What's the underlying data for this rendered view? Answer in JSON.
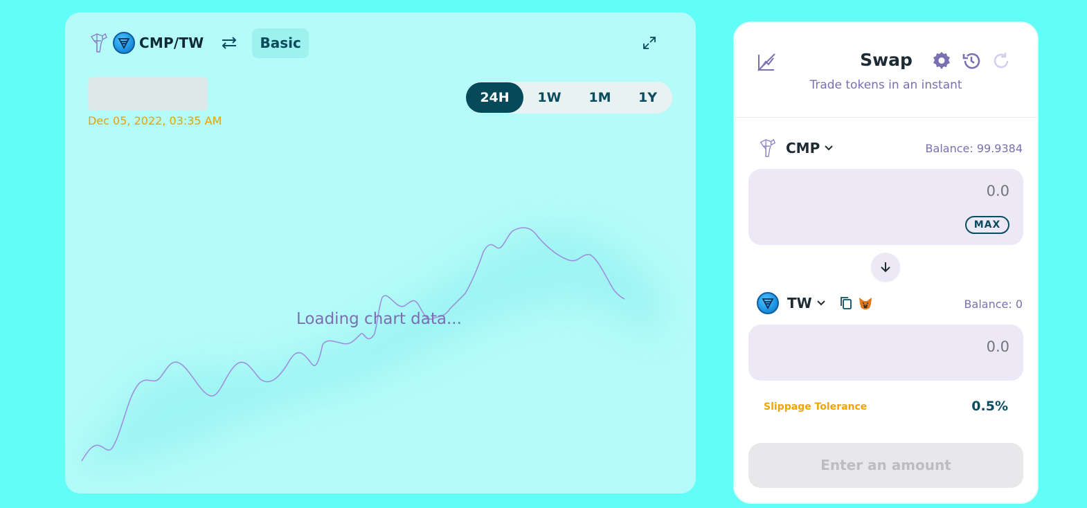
{
  "chart_panel": {
    "pair_label": "CMP/TW",
    "basic_label": "Basic",
    "date": "Dec 05, 2022, 03:35 AM",
    "ranges": [
      "24H",
      "1W",
      "1M",
      "1Y"
    ],
    "active_range": "24H",
    "loading_text": "Loading chart data..."
  },
  "swap": {
    "title": "Swap",
    "subtitle": "Trade tokens in an instant",
    "from": {
      "symbol": "CMP",
      "balance": "Balance: 99.9384",
      "amount_placeholder": "0.0",
      "max_label": "MAX"
    },
    "to": {
      "symbol": "TW",
      "balance": "Balance: 0",
      "amount_placeholder": "0.0"
    },
    "slippage_label": "Slippage Tolerance",
    "slippage_value": "0.5%",
    "submit_label": "Enter an amount"
  },
  "colors": {
    "background": "#62fdf7",
    "panel": "#b4fbf9",
    "accent": "#06495a",
    "purple": "#7a6fb0",
    "orange": "#e8a200"
  },
  "icons": {
    "cmp": "cmp-token-icon",
    "tw": "tw-token-icon",
    "swap_pair": "swap-arrows-icon",
    "expand": "expand-icon",
    "chart_toggle": "chart-toggle-icon",
    "settings": "gear-icon",
    "history": "history-icon",
    "refresh": "refresh-icon",
    "copy": "copy-icon",
    "wallet": "metamask-fox-icon"
  }
}
